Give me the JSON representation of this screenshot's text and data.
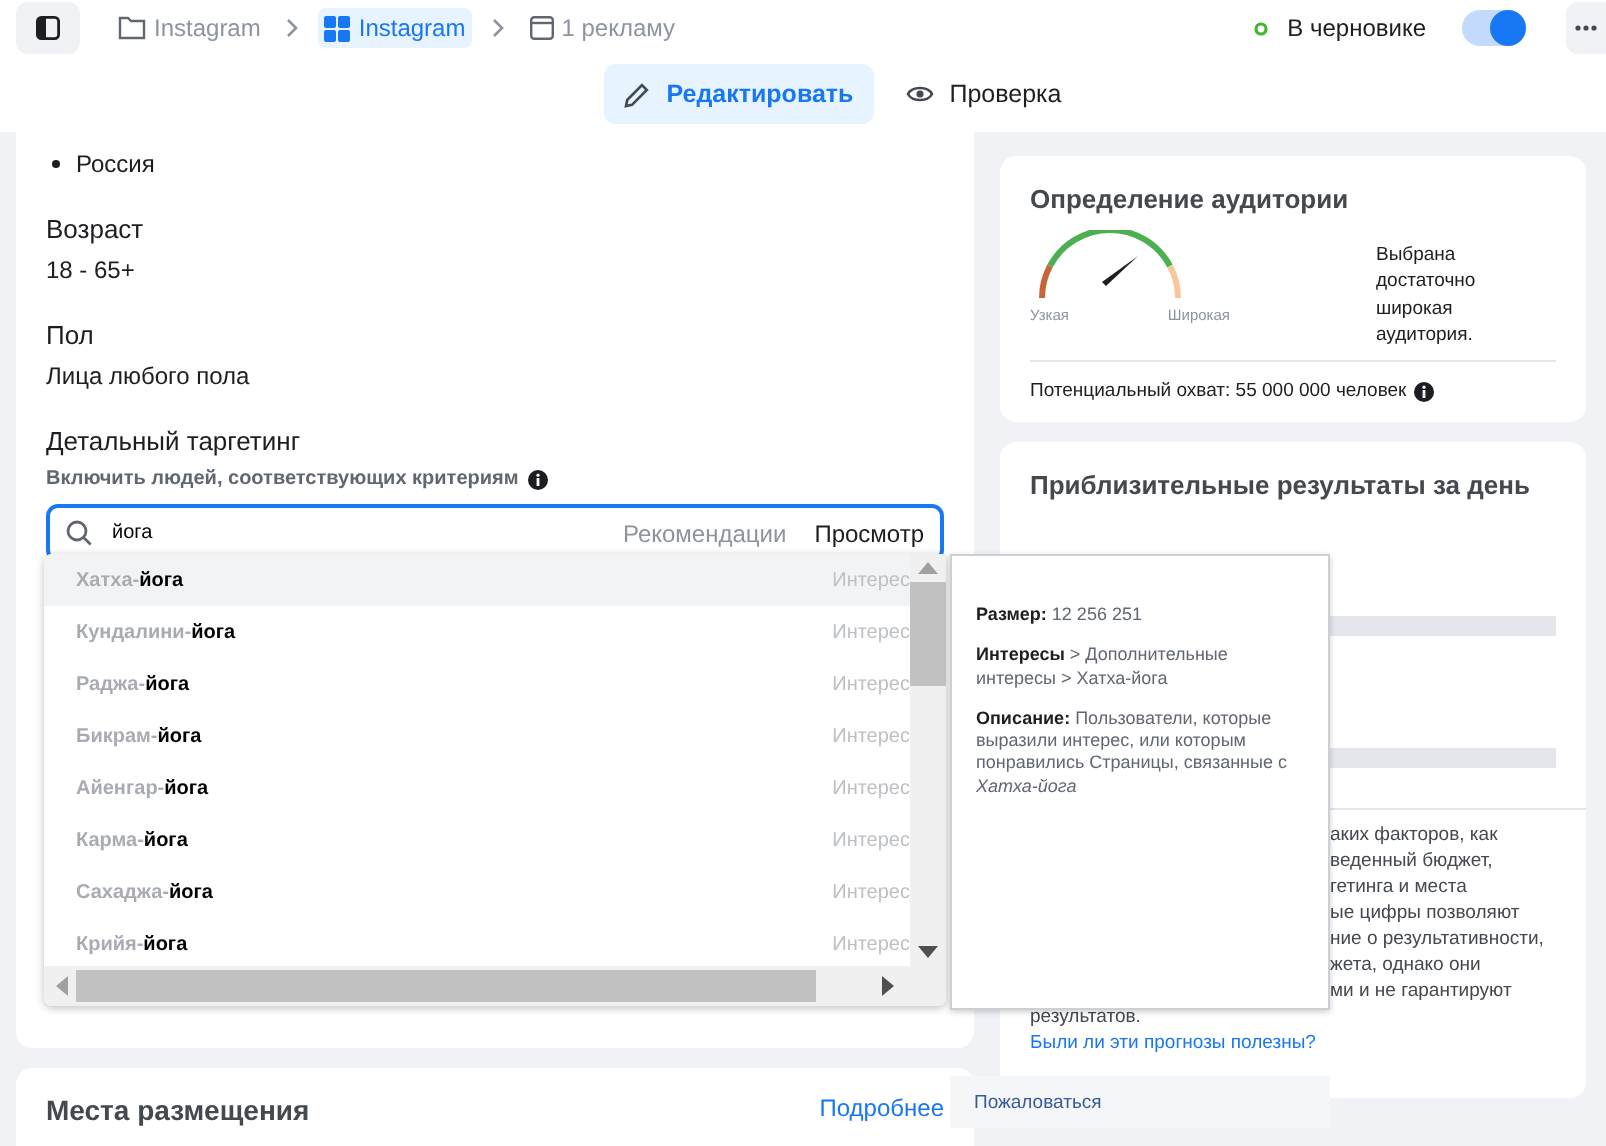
{
  "breadcrumbs": [
    {
      "label": "Instagram",
      "kind": "folder",
      "selected": false
    },
    {
      "label": "Instagram",
      "kind": "grid",
      "selected": true
    },
    {
      "label": "1 рекламу",
      "kind": "ad",
      "selected": false
    }
  ],
  "status": {
    "label": "В черновике"
  },
  "publish_toggle": {
    "on": true
  },
  "mode_tabs": [
    {
      "label": "Редактировать",
      "kind": "edit",
      "selected": true
    },
    {
      "label": "Проверка",
      "kind": "review",
      "selected": false
    }
  ],
  "audience": {
    "locations": [
      "Россия"
    ],
    "fields": [
      {
        "label": "Возраст",
        "value": "18 - 65+"
      },
      {
        "label": "Пол",
        "value": "Лица любого пола"
      }
    ],
    "detailed_targeting": {
      "title": "Детальный таргетинг",
      "subtitle": "Включить людей, соответствующих критериям",
      "search": {
        "value": "йога",
        "modes": [
          {
            "label": "Рекомендации",
            "selected": false
          },
          {
            "label": "Просмотр",
            "selected": true
          }
        ]
      }
    }
  },
  "suggestions": [
    {
      "name_prefix": "Хатха-",
      "name_match": "йога",
      "category": "Интерес",
      "selected": true
    },
    {
      "name_prefix": "Кундалини-",
      "name_match": "йога",
      "category": "Интерес",
      "selected": false
    },
    {
      "name_prefix": "Раджа-",
      "name_match": "йога",
      "category": "Интерес",
      "selected": false
    },
    {
      "name_prefix": "Бикрам-",
      "name_match": "йога",
      "category": "Интерес",
      "selected": false
    },
    {
      "name_prefix": "Айенгар-",
      "name_match": "йога",
      "category": "Интерес",
      "selected": false
    },
    {
      "name_prefix": "Карма-",
      "name_match": "йога",
      "category": "Интерес",
      "selected": false
    },
    {
      "name_prefix": "Сахаджа-",
      "name_match": "йога",
      "category": "Интерес",
      "selected": false
    },
    {
      "name_prefix": "Крийя-",
      "name_match": "йога",
      "category": "Интерес",
      "selected": false
    }
  ],
  "suggestion_detail": {
    "paragraphs": [
      "**Размер:** 12 256 251",
      "**Интересы** > Дополнительные интересы > Хатха-йога",
      "**Описание:** Пользователи, которые выразили интерес, или которым понравились Страницы, связанные с *Хатха-йога*"
    ]
  },
  "report_link": "Пожаловаться",
  "audience_definition": {
    "title": "Определение аудитории",
    "gauge_min": "Узкая",
    "gauge_max": "Широкая",
    "verdict": "Выбрана достаточно широкая аудитория.",
    "reach": "Потенциальный охват: 55 000 000 человек"
  },
  "daily_results": {
    "title": "Приблизительные результаты за день",
    "disclaimer_lines": [
      "аких факторов, как",
      "веденный бюджет,",
      "гетинга и места",
      "ые цифры позволяют",
      "ние о результативности,",
      "жета, однако они",
      "ми и не гарантируют"
    ],
    "disclaimer_end": "результатов.",
    "feedback_link": "Были ли эти прогнозы полезны?"
  },
  "placements": {
    "title": "Места размещения",
    "link": "Подробнее"
  }
}
